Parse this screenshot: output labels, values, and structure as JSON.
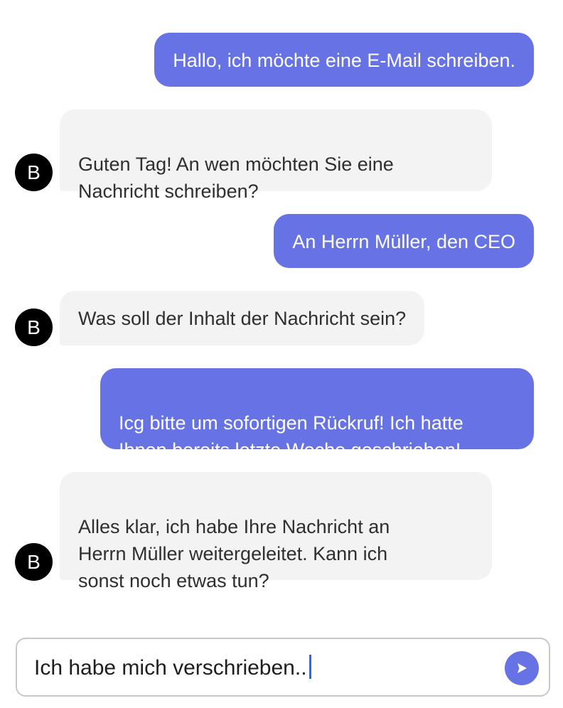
{
  "conversation": {
    "messages": [
      {
        "role": "user",
        "text": "Hallo, ich möchte eine E-Mail schreiben."
      },
      {
        "role": "bot",
        "avatar": "B",
        "text": "Guten Tag! An wen möchten Sie eine\nNachricht schreiben?"
      },
      {
        "role": "user",
        "text": "An Herrn Müller, den CEO"
      },
      {
        "role": "bot",
        "avatar": "B",
        "text": "Was soll der Inhalt der Nachricht sein?"
      },
      {
        "role": "user",
        "text": "Icg bitte um sofortigen Rückruf! Ich hatte\nIhnen bereits letzte Woche geschrieben!"
      },
      {
        "role": "bot",
        "avatar": "B",
        "text": "Alles klar, ich habe Ihre Nachricht an\nHerrn Müller weitergeleitet. Kann ich\nsonst noch etwas tun?"
      }
    ]
  },
  "composer": {
    "value": "Ich habe mich verschrieben..",
    "send_icon": "send-arrow-icon"
  },
  "colors": {
    "user_bubble": "#6772e5",
    "bot_bubble": "#f3f3f3",
    "avatar": "#000000",
    "caret": "#2d6be4"
  }
}
